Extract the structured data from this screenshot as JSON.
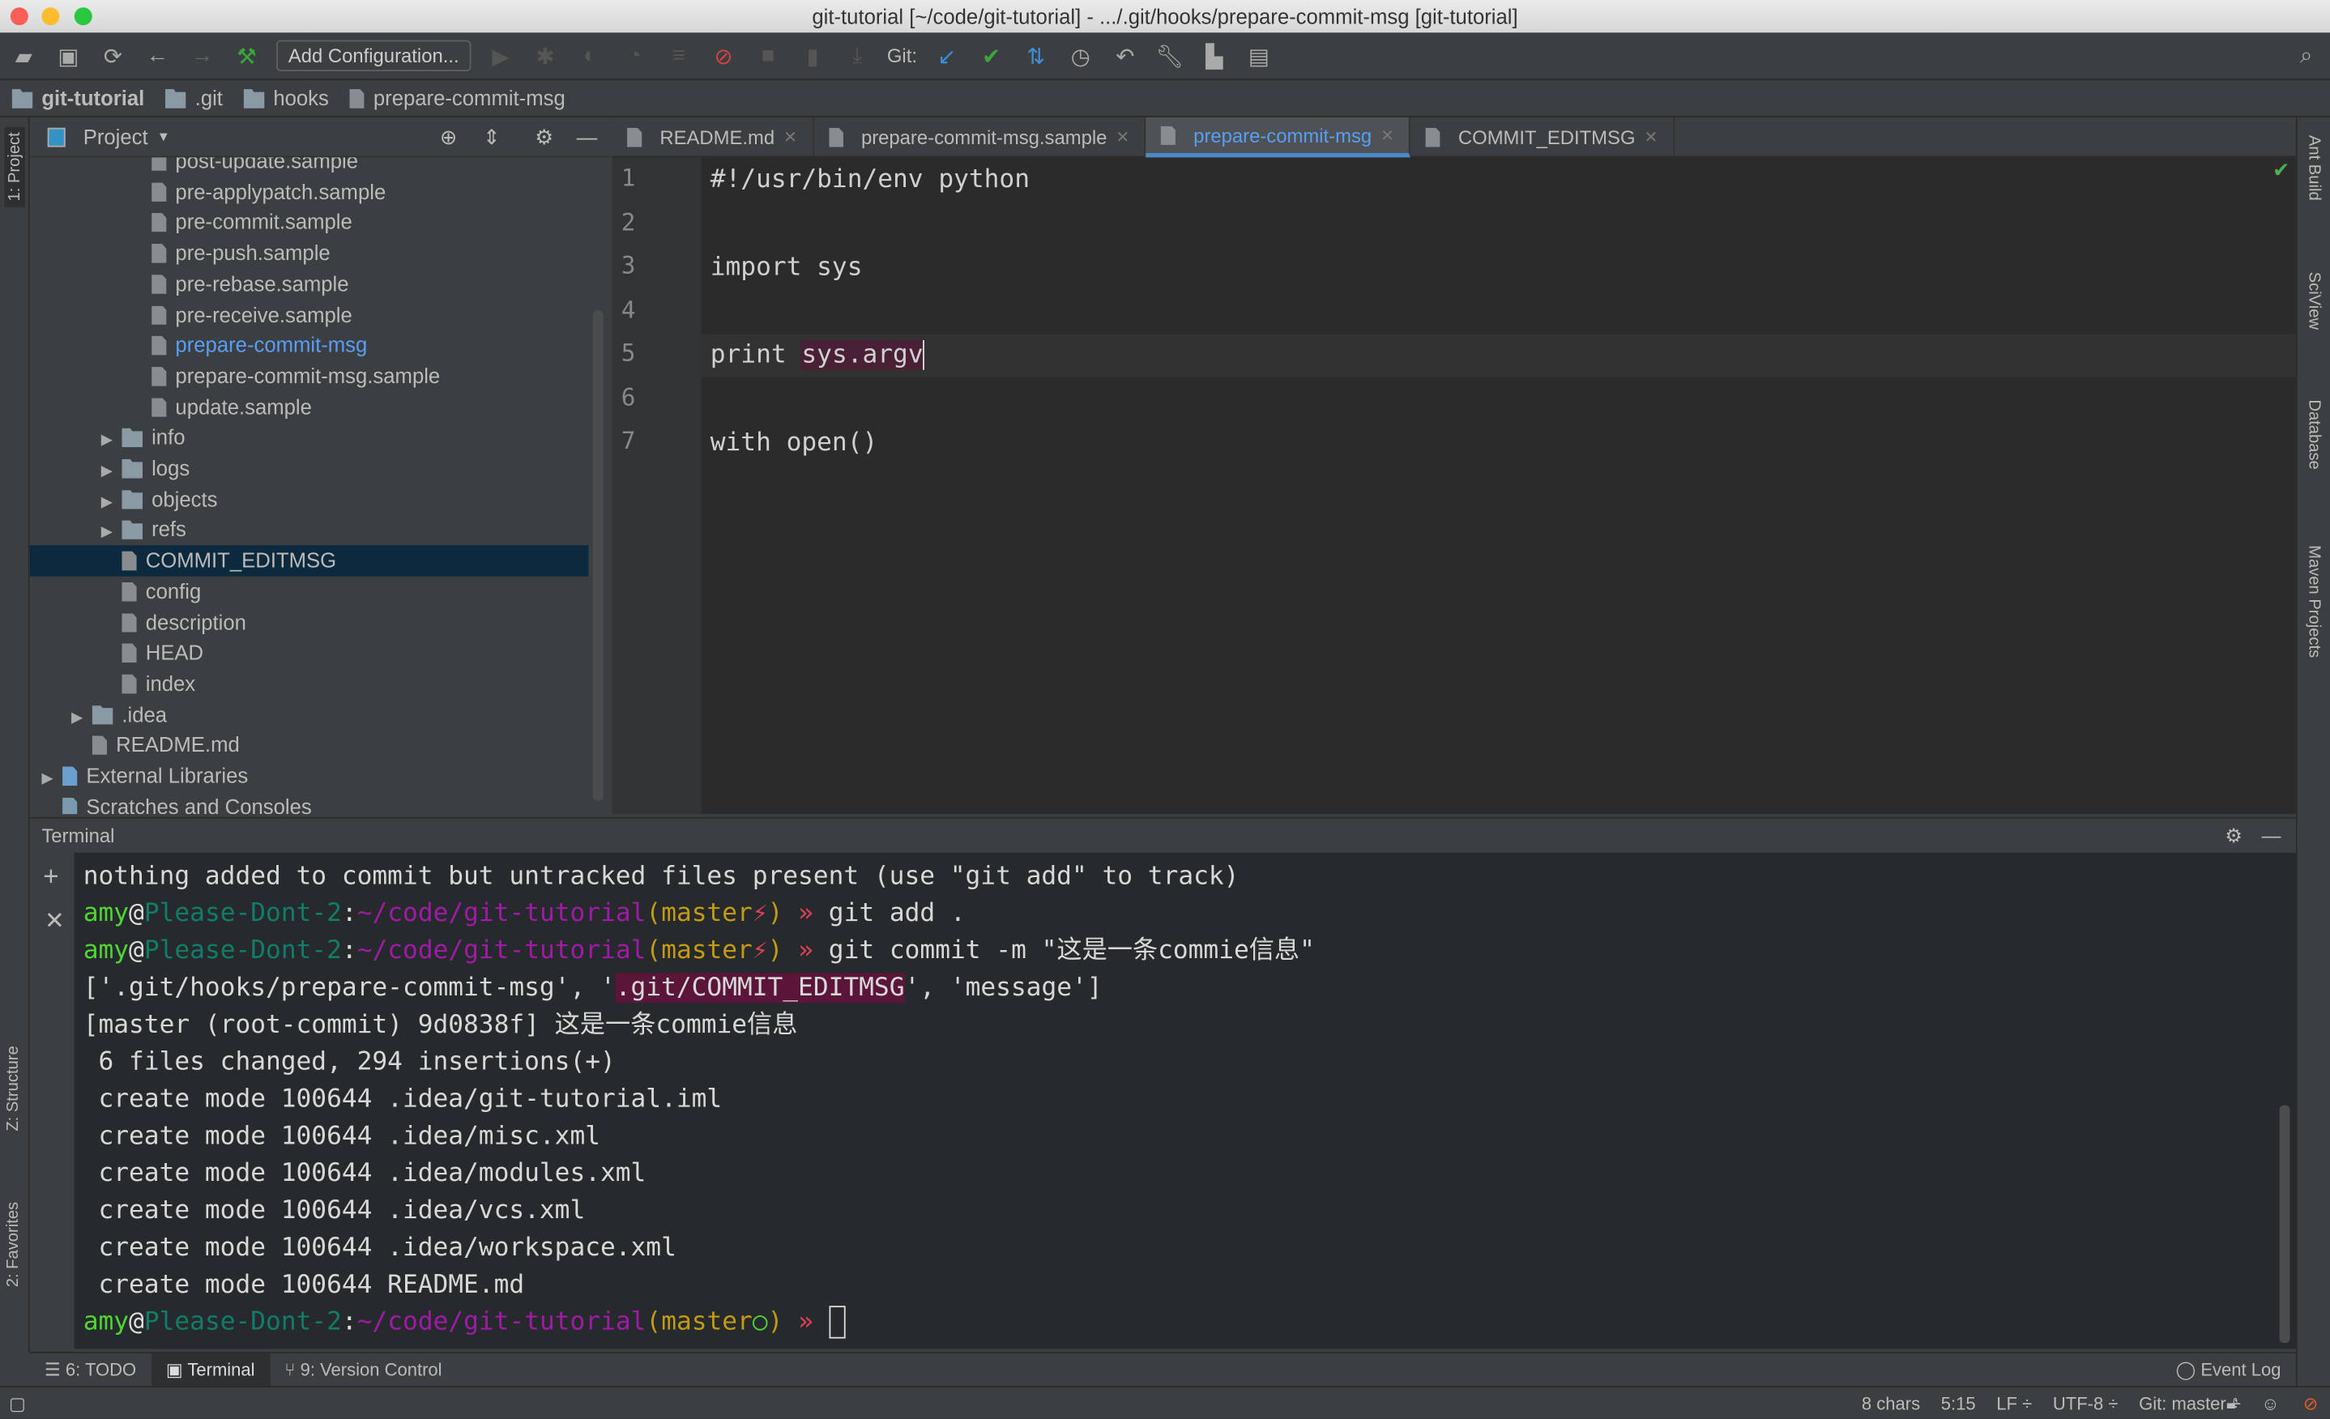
{
  "window": {
    "title": "git-tutorial [~/code/git-tutorial] - .../.git/hooks/prepare-commit-msg [git-tutorial]"
  },
  "toolbar": {
    "add_configuration": "Add Configuration...",
    "git_label": "Git:"
  },
  "breadcrumb": [
    "git-tutorial",
    ".git",
    "hooks",
    "prepare-commit-msg"
  ],
  "left_strip": {
    "project": "1: Project",
    "structure": "Z: Structure",
    "favorites": "2: Favorites"
  },
  "right_strip": [
    "Ant Build",
    "SciView",
    "Database",
    "Maven Projects"
  ],
  "project": {
    "title": "Project",
    "items": [
      {
        "label": "post-update.sample",
        "type": "file",
        "depth": 4
      },
      {
        "label": "pre-applypatch.sample",
        "type": "file",
        "depth": 4
      },
      {
        "label": "pre-commit.sample",
        "type": "file",
        "depth": 4
      },
      {
        "label": "pre-push.sample",
        "type": "file",
        "depth": 4
      },
      {
        "label": "pre-rebase.sample",
        "type": "file",
        "depth": 4
      },
      {
        "label": "pre-receive.sample",
        "type": "file",
        "depth": 4
      },
      {
        "label": "prepare-commit-msg",
        "type": "file",
        "depth": 4,
        "highlight": true
      },
      {
        "label": "prepare-commit-msg.sample",
        "type": "file",
        "depth": 4
      },
      {
        "label": "update.sample",
        "type": "file",
        "depth": 4
      },
      {
        "label": "info",
        "type": "folder",
        "depth": 3
      },
      {
        "label": "logs",
        "type": "folder",
        "depth": 3
      },
      {
        "label": "objects",
        "type": "folder",
        "depth": 3
      },
      {
        "label": "refs",
        "type": "folder",
        "depth": 3
      },
      {
        "label": "COMMIT_EDITMSG",
        "type": "file",
        "depth": 3,
        "selected": true
      },
      {
        "label": "config",
        "type": "file",
        "depth": 3
      },
      {
        "label": "description",
        "type": "file",
        "depth": 3
      },
      {
        "label": "HEAD",
        "type": "file",
        "depth": 3
      },
      {
        "label": "index",
        "type": "file",
        "depth": 3
      },
      {
        "label": ".idea",
        "type": "folder",
        "depth": 2
      },
      {
        "label": "README.md",
        "type": "file",
        "depth": 2
      },
      {
        "label": "External Libraries",
        "type": "library",
        "depth": 1
      },
      {
        "label": "Scratches and Consoles",
        "type": "scratch",
        "depth": 1
      }
    ]
  },
  "tabs": [
    {
      "label": "README.md",
      "active": false
    },
    {
      "label": "prepare-commit-msg.sample",
      "active": false
    },
    {
      "label": "prepare-commit-msg",
      "active": true
    },
    {
      "label": "COMMIT_EDITMSG",
      "active": false
    }
  ],
  "editor": {
    "lines": [
      "#!/usr/bin/env python",
      "",
      "import sys",
      "",
      "print sys.argv",
      "",
      "with open()"
    ],
    "current_line": 5
  },
  "terminal": {
    "title": "Terminal",
    "line0": "nothing added to commit but untracked files present (use \"git add\" to track)",
    "prompt": {
      "user": "amy",
      "at": "@",
      "host": "Please-Dont-2",
      "colon": ":",
      "path": "~/code/git-tutorial",
      "lp": "(",
      "branch": "master",
      "dirty": "⚡",
      "clean": "○",
      "rp": ")",
      "arrow": " » "
    },
    "cmd1": "git add .",
    "cmd2": "git commit -m \"这是一条commie信息\"",
    "argv_pre": "['.git/hooks/prepare-commit-msg', '",
    "argv_hl": ".git/COMMIT_EDITMSG",
    "argv_post": "', 'message']",
    "output": [
      "[master (root-commit) 9d0838f] 这是一条commie信息",
      " 6 files changed, 294 insertions(+)",
      " create mode 100644 .idea/git-tutorial.iml",
      " create mode 100644 .idea/misc.xml",
      " create mode 100644 .idea/modules.xml",
      " create mode 100644 .idea/vcs.xml",
      " create mode 100644 .idea/workspace.xml",
      " create mode 100644 README.md"
    ]
  },
  "bottom_tabs": [
    {
      "label": "6: TODO"
    },
    {
      "label": "Terminal",
      "active": true
    },
    {
      "label": "9: Version Control"
    }
  ],
  "event_log": "Event Log",
  "status": {
    "chars": "8 chars",
    "position": "5:15",
    "line_sep": "LF ÷",
    "encoding": "UTF-8 ÷",
    "git": "Git: master ÷"
  }
}
